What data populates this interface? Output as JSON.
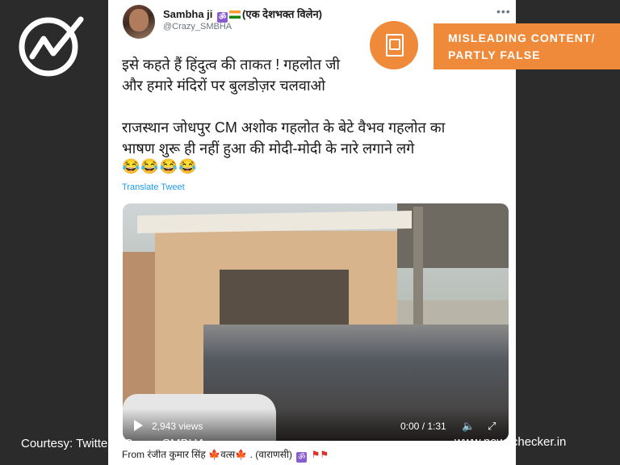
{
  "tweet": {
    "name": "Sambha ji",
    "name_suffix": "(एक देशभक्त विलेन)",
    "handle": "@Crazy_SMBHA",
    "more_icon": "more-horizontal-icon",
    "line1": "इसे कहते हैं हिंदुत्व की ताकत ! गहलोत जी",
    "line2": "और हमारे मंदिरों पर बुलडोज़र चलवाओ",
    "line3": "राजस्थान जोधपुर CM अशोक गहलोत के बेटे वैभव गहलोत का",
    "line4": "भाषण शुरू ही नहीं हुआ की मोदी-मोदी के नारे लगाने लगे",
    "emoji": "😂😂😂😂",
    "translate": "Translate Tweet",
    "video": {
      "views": "2,943 views",
      "time": "0:00 / 1:31"
    },
    "from_label": "From",
    "from_name": "रंजीत कुमार सिंह",
    "from_name2": "वत्स",
    "from_place": ". (वाराणसी)"
  },
  "overlay": {
    "verdict_line1": "MISLEADING CONTENT/",
    "verdict_line2": "PARTLY FALSE",
    "courtesy": "Courtesy: Twitter@Crazy_SMBHA",
    "site": "www.newschecker.in",
    "accent": "#ef8a3a"
  }
}
